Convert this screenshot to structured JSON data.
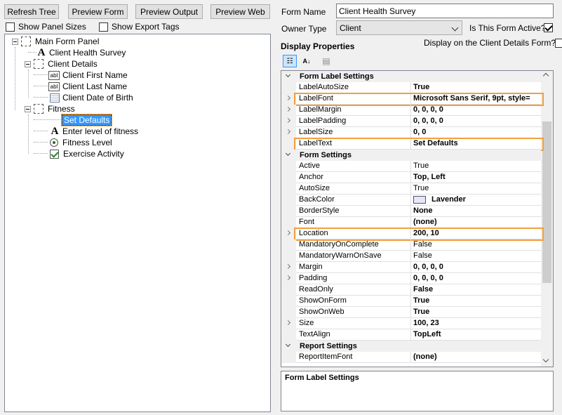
{
  "toolbar": {
    "refresh_tree": "Refresh Tree",
    "preview_form": "Preview Form",
    "preview_output": "Preview Output",
    "preview_web": "Preview Web"
  },
  "options": {
    "show_panel_sizes": "Show Panel Sizes",
    "show_export_tags": "Show Export Tags"
  },
  "tree": {
    "main_form_panel": "Main Form Panel",
    "client_health_survey": "Client Health Survey",
    "client_details": "Client Details",
    "client_first_name": "Client First Name",
    "client_last_name": "Client Last Name",
    "client_dob": "Client Date of Birth",
    "fitness": "Fitness",
    "set_defaults": "Set Defaults",
    "enter_level": "Enter level of fitness",
    "fitness_level": "Fitness Level",
    "exercise_activity": "Exercise Activity"
  },
  "form": {
    "form_name_label": "Form Name",
    "form_name_value": "Client Health Survey",
    "owner_type_label": "Owner Type",
    "owner_type_value": "Client",
    "is_active_label": "Is This Form Active?",
    "display_client_label": "Display on the Client Details Form?",
    "display_properties": "Display Properties"
  },
  "grid": {
    "cat_form_label": "Form Label Settings",
    "cat_form": "Form Settings",
    "cat_report": "Report Settings",
    "rows_label": [
      {
        "name": "LabelAutoSize",
        "value": "True"
      },
      {
        "name": "LabelFont",
        "value": "Microsoft Sans Serif, 9pt, style="
      },
      {
        "name": "LabelMargin",
        "value": "0, 0, 0, 0"
      },
      {
        "name": "LabelPadding",
        "value": "0, 0, 0, 0"
      },
      {
        "name": "LabelSize",
        "value": "0, 0"
      },
      {
        "name": "LabelText",
        "value": "Set Defaults"
      }
    ],
    "rows_form": [
      {
        "name": "Active",
        "value": "True"
      },
      {
        "name": "Anchor",
        "value": "Top, Left"
      },
      {
        "name": "AutoSize",
        "value": "True"
      },
      {
        "name": "BackColor",
        "value": "Lavender"
      },
      {
        "name": "BorderStyle",
        "value": "None"
      },
      {
        "name": "Font",
        "value": "(none)"
      },
      {
        "name": "Location",
        "value": "200, 10"
      },
      {
        "name": "MandatoryOnComplete",
        "value": "False"
      },
      {
        "name": "MandatoryWarnOnSave",
        "value": "False"
      },
      {
        "name": "Margin",
        "value": "0, 0, 0, 0"
      },
      {
        "name": "Padding",
        "value": "0, 0, 0, 0"
      },
      {
        "name": "ReadOnly",
        "value": "False"
      },
      {
        "name": "ShowOnForm",
        "value": "True"
      },
      {
        "name": "ShowOnWeb",
        "value": "True"
      },
      {
        "name": "Size",
        "value": "100, 23"
      },
      {
        "name": "TextAlign",
        "value": "TopLeft"
      }
    ],
    "rows_report": [
      {
        "name": "ReportItemFont",
        "value": "(none)"
      }
    ],
    "description": "Form Label Settings",
    "backcolor_hex": "#e6e6fa"
  }
}
